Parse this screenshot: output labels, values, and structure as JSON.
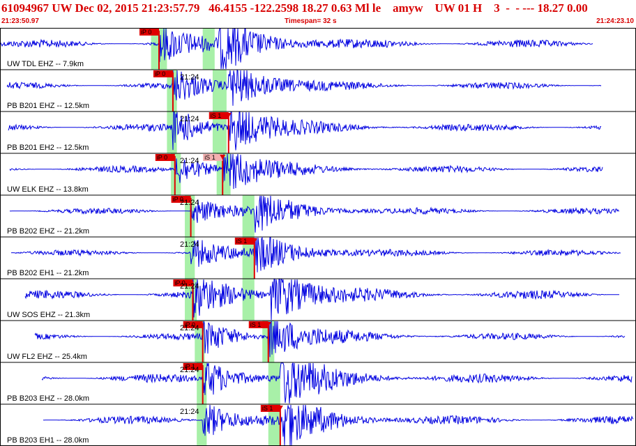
{
  "header": {
    "title": "61094967 UW Dec 02, 2015 21:23:57.79   46.4155 -122.2598 18.27 0.63 Ml le    amyw    UW 01 H    3  -  - --- 18.27 0.00",
    "start_time": "21:23:50.97",
    "timespan": "Timespan=  32 s",
    "end_time": "21:24:23.10"
  },
  "colors": {
    "trace": "#0000e0",
    "pick": "#e00000",
    "pick_weak": "#f4b0b0",
    "window": "#a8f0a8",
    "border": "#000000",
    "header_text": "#d80000"
  },
  "chart_data": {
    "type": "seismogram",
    "x_range_s": [
      0,
      32
    ],
    "time_label": "21:24",
    "traces": [
      {
        "label": "UW TDL EHZ -- 7.9km",
        "p_label": "iP 0",
        "p_time": 8.0,
        "s_label": "",
        "s_time": 11.0,
        "windows": [
          [
            7.6,
            8.4
          ],
          [
            10.2,
            10.8
          ]
        ],
        "amplitude": 1.2
      },
      {
        "label": "PB B201 EHZ -- 12.5km",
        "p_label": "iP 0",
        "p_time": 8.7,
        "s_label": "",
        "s_time": null,
        "windows": [
          [
            8.4,
            8.9
          ],
          [
            10.7,
            11.4
          ]
        ],
        "amplitude": 1.0
      },
      {
        "label": "PB B201 EH2 -- 12.5km",
        "p_label": "",
        "p_time": null,
        "s_label": "iS 1",
        "s_time": 11.5,
        "windows": [
          [
            8.4,
            8.9
          ],
          [
            10.7,
            11.4
          ]
        ],
        "amplitude": 1.1
      },
      {
        "label": "UW ELK EHZ -- 13.8km",
        "p_label": "iP 0",
        "p_time": 8.8,
        "s_label": "iS 1",
        "s_time": 11.2,
        "windows": [
          [
            8.6,
            9.1
          ],
          [
            10.9,
            11.6
          ]
        ],
        "amplitude": 1.0
      },
      {
        "label": "PB B202 EHZ -- 21.2km",
        "p_label": "iP 0",
        "p_time": 9.6,
        "s_label": "",
        "s_time": null,
        "windows": [
          [
            9.3,
            9.8
          ],
          [
            12.2,
            12.8
          ]
        ],
        "amplitude": 0.9
      },
      {
        "label": "PB B202 EH1 -- 21.2km",
        "p_label": "",
        "p_time": null,
        "s_label": "iS 1",
        "s_time": 12.8,
        "windows": [
          [
            9.3,
            9.8
          ],
          [
            12.2,
            12.8
          ]
        ],
        "amplitude": 0.9
      },
      {
        "label": "UW SOS EHZ -- 21.3km",
        "p_label": "iP 0",
        "p_time": 9.7,
        "s_label": "",
        "s_time": 13.6,
        "windows": [
          [
            9.3,
            9.9
          ],
          [
            12.2,
            12.8
          ]
        ],
        "amplitude": 1.3
      },
      {
        "label": "UW FL2 EHZ -- 25.4km",
        "p_label": "iP 0",
        "p_time": 10.2,
        "s_label": "iS 1",
        "s_time": 13.5,
        "windows": [
          [
            9.8,
            10.3
          ],
          [
            13.2,
            13.8
          ]
        ],
        "amplitude": 1.0
      },
      {
        "label": "PB B203 EHZ -- 28.0km",
        "p_label": "iP 1",
        "p_time": 10.2,
        "s_label": "",
        "s_time": null,
        "windows": [
          [
            9.9,
            10.4
          ],
          [
            13.5,
            14.1
          ]
        ],
        "amplitude": 1.3
      },
      {
        "label": "PB B203 EH1 -- 28.0km",
        "p_label": "",
        "p_time": null,
        "s_label": "iS 1",
        "s_time": 14.1,
        "windows": [
          [
            9.9,
            10.4
          ],
          [
            13.5,
            14.1
          ]
        ],
        "amplitude": 1.2
      }
    ]
  }
}
